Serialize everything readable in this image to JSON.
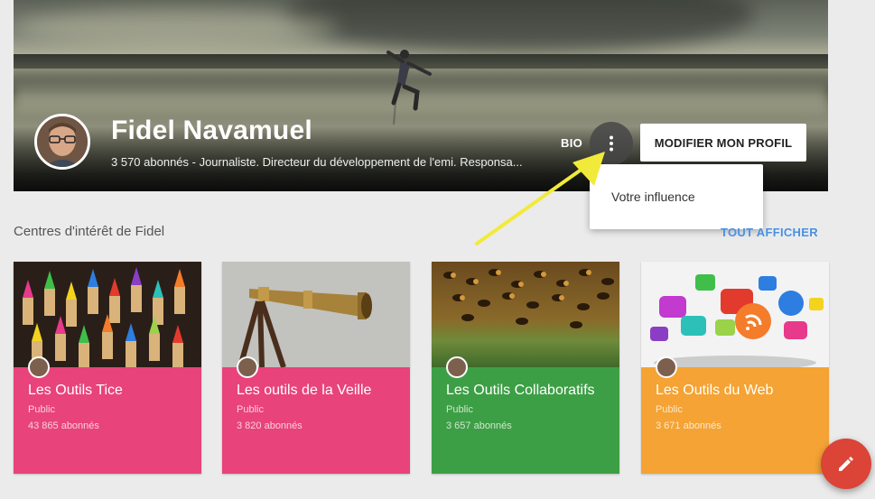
{
  "profile": {
    "name": "Fidel Navamuel",
    "subtitle": "3 570 abonnés - Journaliste. Directeur du développement de l'emi. Responsa...",
    "bio_label": "BIO",
    "edit_button": "MODIFIER MON PROFIL"
  },
  "menu": {
    "item_influence": "Votre influence"
  },
  "section": {
    "title": "Centres d'intérêt de Fidel",
    "show_all": "TOUT AFFICHER"
  },
  "collections": [
    {
      "title": "Les Outils Tice",
      "visibility": "Public",
      "followers": "43 865 abonnés",
      "color": "#e8437a"
    },
    {
      "title": "Les outils de la Veille",
      "visibility": "Public",
      "followers": "3 820 abonnés",
      "color": "#e8437a"
    },
    {
      "title": "Les Outils Collaboratifs",
      "visibility": "Public",
      "followers": "3 657 abonnés",
      "color": "#3d9f45"
    },
    {
      "title": "Les Outils du Web",
      "visibility": "Public",
      "followers": "3 671 abonnés",
      "color": "#f4a334"
    }
  ],
  "colors": {
    "accent_link": "#4a90e2",
    "fab": "#db4437",
    "arrow": "#f2ea3a"
  },
  "icons": {
    "more": "more-vert-icon",
    "fab": "pencil-icon"
  }
}
